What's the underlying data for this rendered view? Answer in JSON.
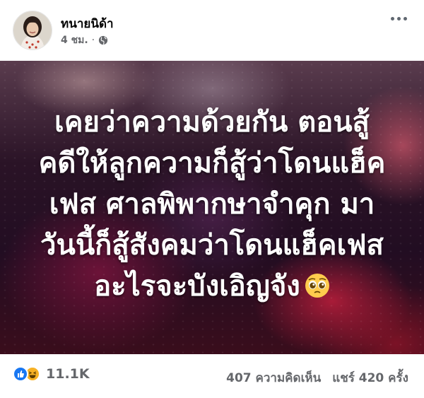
{
  "post": {
    "author": "ทนายนิด้า",
    "time": "4 ชม.",
    "privacy_icon": "globe-icon",
    "more_icon": "more-options-icon"
  },
  "image": {
    "lines": [
      "เคยว่าความด้วยกัน ตอนสู้",
      "คดีให้ลูกความก็สู้ว่าโดนแฮ็ค",
      "เฟส ศาลพิพากษาจำคุก มา",
      "วันนี้ก็สู้สังคมว่าโดนแฮ็คเฟส",
      "อะไรจะบังเอิญจัง"
    ],
    "emoji": "pleading-face-emoji"
  },
  "stats": {
    "reaction_icons": [
      "like-icon",
      "haha-icon"
    ],
    "reactions_count": "11.1K",
    "comments": "407 ความคิดเห็น",
    "shares": "แชร์ 420 ครั้ง"
  }
}
